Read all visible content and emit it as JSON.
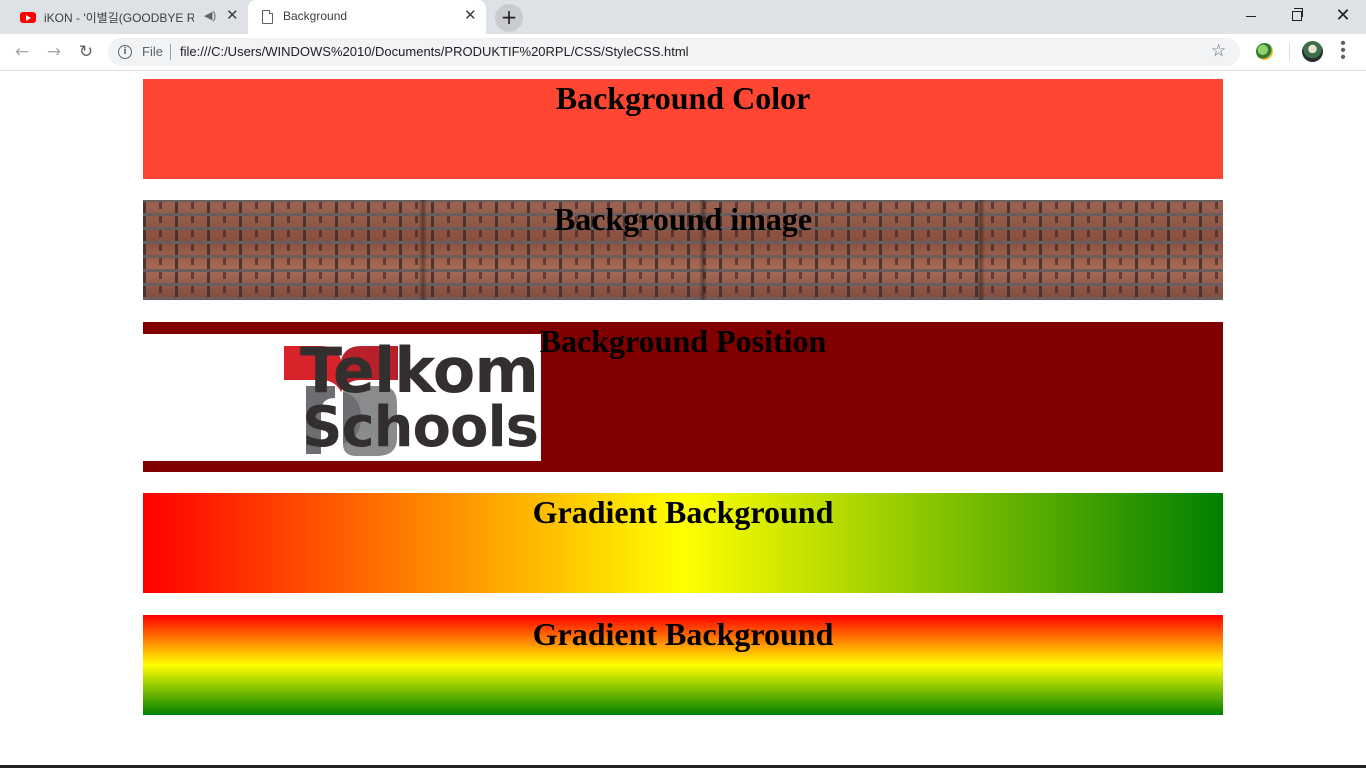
{
  "browser": {
    "tabs": [
      {
        "title": "iKON - '이별길(GOODBYE RO",
        "favicon": "youtube-icon",
        "audio": true,
        "active": false
      },
      {
        "title": "Background",
        "favicon": "document-icon",
        "audio": false,
        "active": true
      }
    ],
    "new_tab_symbol": "+",
    "window_controls": {
      "close_symbol": "✕"
    },
    "toolbar": {
      "back_symbol": "←",
      "forward_symbol": "→",
      "reload_symbol": "↻",
      "scheme_label": "File",
      "url": "file:///C:/Users/WINDOWS%2010/Documents/PRODUKTIF%20RPL/CSS/StyleCSS.html",
      "bookmark_symbol": "☆",
      "menu_symbol": "⋮"
    }
  },
  "page": {
    "boxes": [
      {
        "heading": "Background Color",
        "background": "#ff4633"
      },
      {
        "heading": "Background image",
        "background": "brick-wall-image"
      },
      {
        "heading": "Background Position",
        "background": "#800000"
      },
      {
        "heading": "Gradient Background",
        "background": "linear-gradient(to right, #ff0000, #ffff00, #008000)"
      },
      {
        "heading": "Gradient Background",
        "background": "linear-gradient(to bottom, #ff0000, #ffff00, #008000)"
      }
    ],
    "logo": {
      "line1": "Telkom",
      "line2": "Schools",
      "red": "#d8232a",
      "grey": "#6d6e71",
      "text_color": "#332f2f"
    }
  }
}
